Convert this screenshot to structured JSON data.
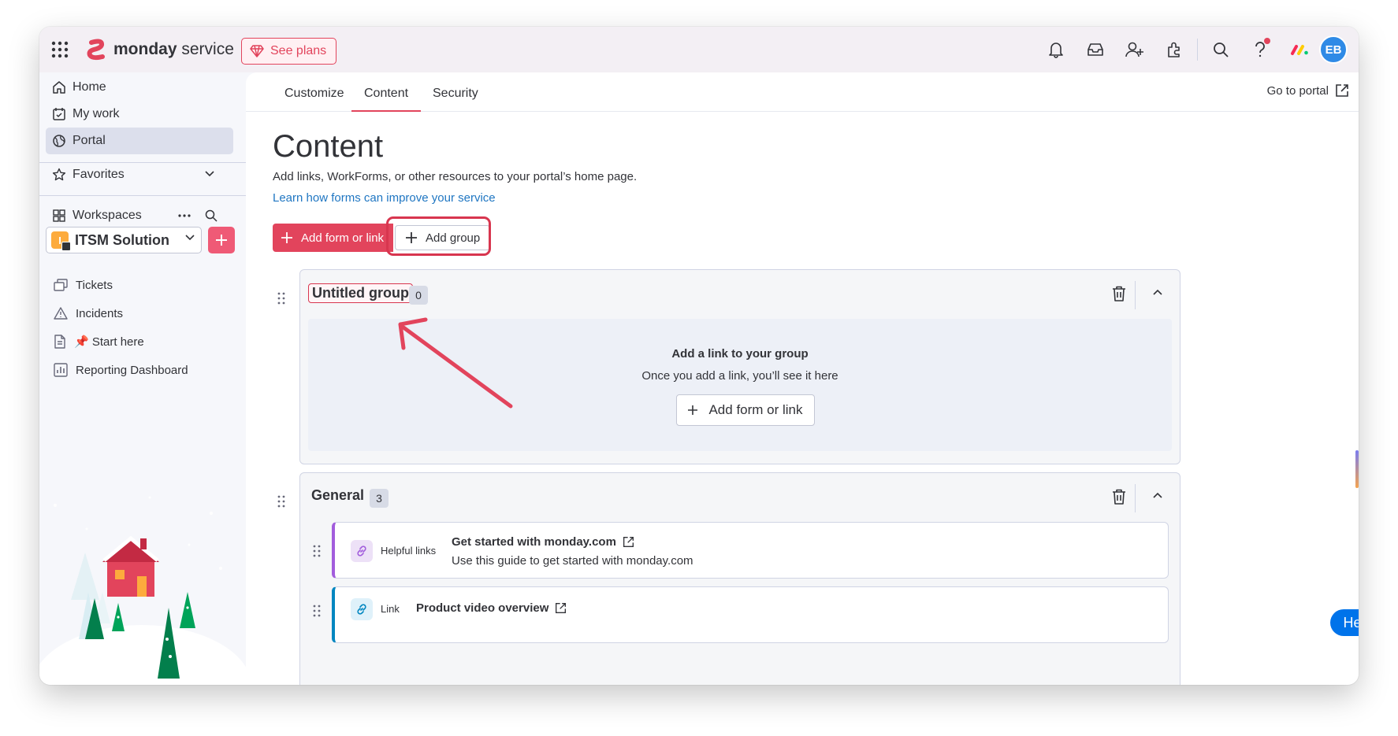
{
  "brand": {
    "name_bold": "monday",
    "name_light": " service",
    "see_plans": "See plans",
    "accent": "#e2445c"
  },
  "topbar": {
    "icons": [
      "bell-icon",
      "inbox-icon",
      "invite-member-icon",
      "apps-marketplace-icon",
      "search-icon",
      "help-icon",
      "monday-products-icon"
    ],
    "avatar_initials": "EB"
  },
  "sidebar": {
    "nav": [
      {
        "label": "Home",
        "icon": "home-icon"
      },
      {
        "label": "My work",
        "icon": "calendar-check-icon"
      },
      {
        "label": "Portal",
        "icon": "globe-icon",
        "active": true
      }
    ],
    "favorites": "Favorites",
    "workspaces": "Workspaces",
    "workspace_selected": "ITSM Solution",
    "workspace_badge": "I",
    "boards": [
      {
        "label": "Tickets",
        "icon": "board-icon"
      },
      {
        "label": "Incidents",
        "icon": "warning-icon"
      },
      {
        "label": "📌 Start here",
        "icon": "doc-icon"
      },
      {
        "label": "Reporting Dashboard",
        "icon": "dashboard-icon"
      }
    ]
  },
  "tabs": [
    {
      "label": "Customize"
    },
    {
      "label": "Content",
      "active": true
    },
    {
      "label": "Security"
    }
  ],
  "go_to_portal": "Go to portal",
  "content": {
    "title": "Content",
    "description": "Add links, WorkForms, or other resources to your portal’s home page.",
    "learn_link": "Learn how forms can improve your service",
    "add_form_button": "Add form or link",
    "add_group_button": "Add group"
  },
  "groups": [
    {
      "title": "Untitled group",
      "count": "0",
      "empty_title": "Add a link to your group",
      "empty_sub": "Once you add a link, you’ll see it here",
      "empty_button": "Add form or link"
    },
    {
      "title": "General",
      "count": "3",
      "links": [
        {
          "category": "Helpful links",
          "title": "Get started with monday.com",
          "description": "Use this guide to get started with monday.com",
          "color": "#a25ddc"
        },
        {
          "category": "Link",
          "title": "Product video overview",
          "description": "",
          "color": "#0086c0"
        }
      ]
    }
  ],
  "help_button": "Help"
}
